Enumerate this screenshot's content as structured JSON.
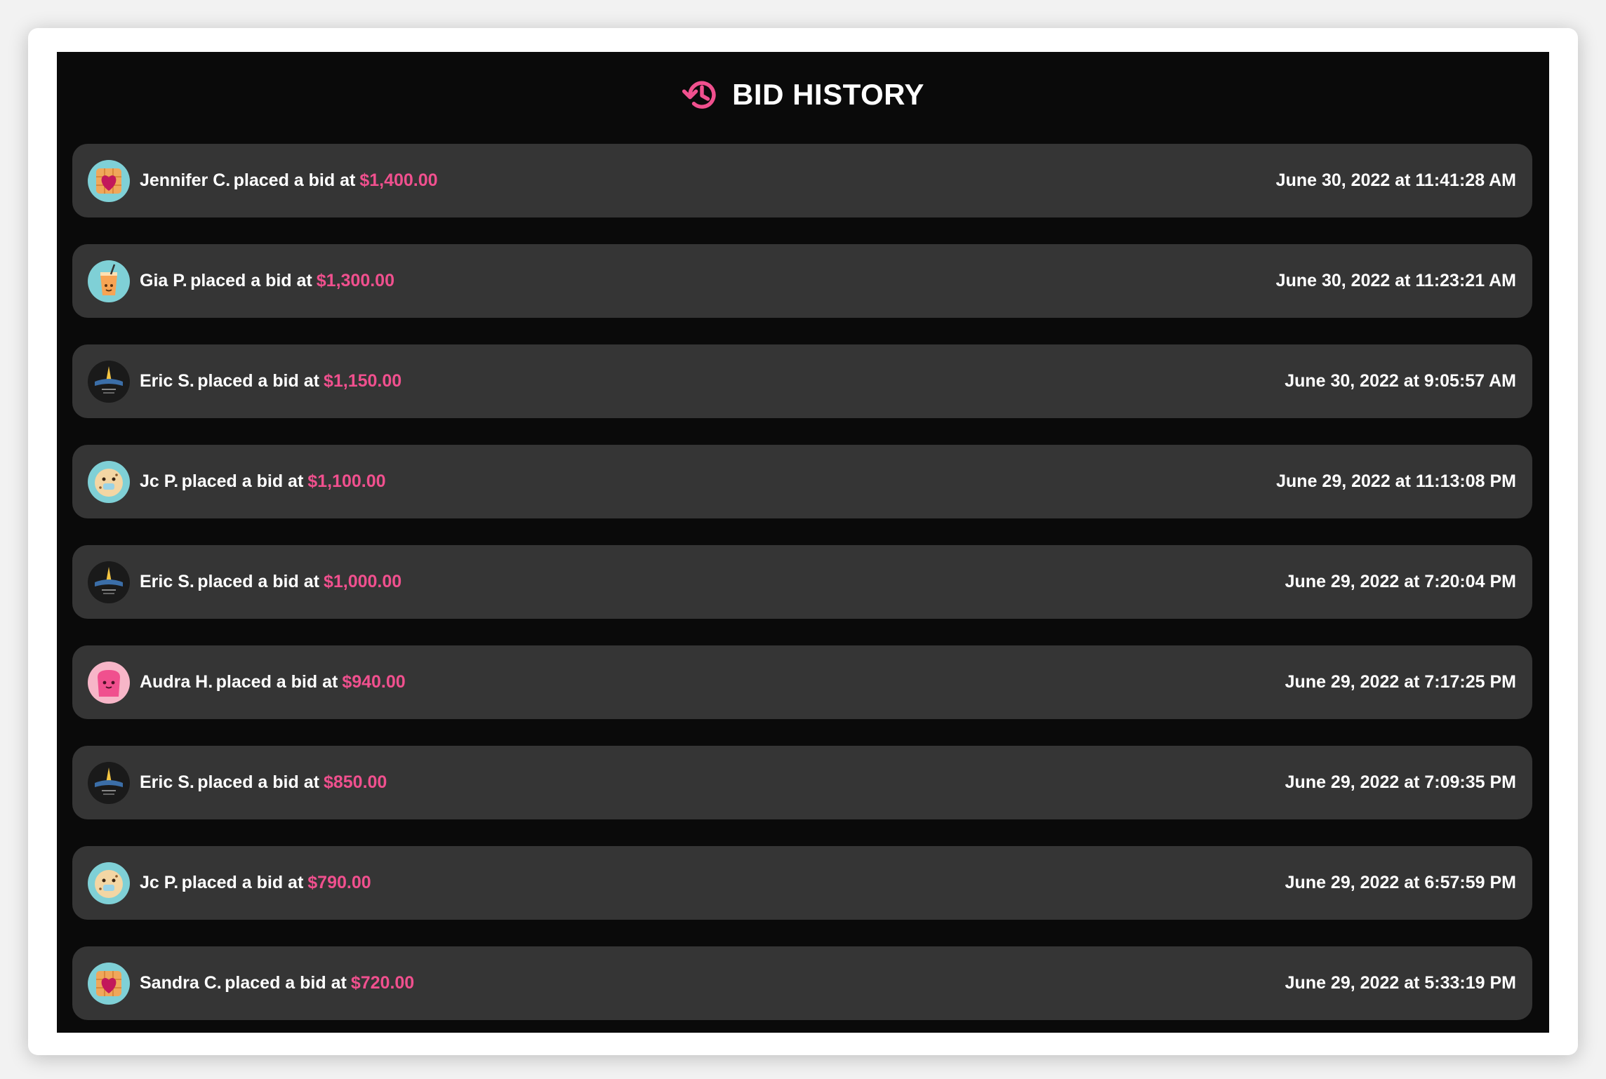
{
  "header": {
    "title": "BID HISTORY",
    "icon": "history-icon",
    "accent": "#f0508e"
  },
  "colors": {
    "panel": "#0a0a0a",
    "row": "#353535",
    "amount": "#f0508e",
    "text": "#ffffff"
  },
  "bids": [
    {
      "bidder": "Jennifer C.",
      "action": "placed a bid at",
      "amount": "$1,400.00",
      "time": "June 30, 2022 at 11:41:28 AM",
      "avatar": "heart-waffle-avatar"
    },
    {
      "bidder": "Gia P.",
      "action": "placed a bid at",
      "amount": "$1,300.00",
      "time": "June 30, 2022 at 11:23:21 AM",
      "avatar": "iced-drink-avatar"
    },
    {
      "bidder": "Eric S.",
      "action": "placed a bid at",
      "amount": "$1,150.00",
      "time": "June 30, 2022 at 9:05:57 AM",
      "avatar": "poster-avatar"
    },
    {
      "bidder": "Jc P.",
      "action": "placed a bid at",
      "amount": "$1,100.00",
      "time": "June 29, 2022 at 11:13:08 PM",
      "avatar": "cookie-avatar"
    },
    {
      "bidder": "Eric S.",
      "action": "placed a bid at",
      "amount": "$1,000.00",
      "time": "June 29, 2022 at 7:20:04 PM",
      "avatar": "poster-avatar"
    },
    {
      "bidder": "Audra H.",
      "action": "placed a bid at",
      "amount": "$940.00",
      "time": "June 29, 2022 at 7:17:25 PM",
      "avatar": "pink-toast-avatar"
    },
    {
      "bidder": "Eric S.",
      "action": "placed a bid at",
      "amount": "$850.00",
      "time": "June 29, 2022 at 7:09:35 PM",
      "avatar": "poster-avatar"
    },
    {
      "bidder": "Jc P.",
      "action": "placed a bid at",
      "amount": "$790.00",
      "time": "June 29, 2022 at 6:57:59 PM",
      "avatar": "cookie-avatar"
    },
    {
      "bidder": "Sandra C.",
      "action": "placed a bid at",
      "amount": "$720.00",
      "time": "June 29, 2022 at 5:33:19 PM",
      "avatar": "heart-waffle-avatar"
    }
  ]
}
